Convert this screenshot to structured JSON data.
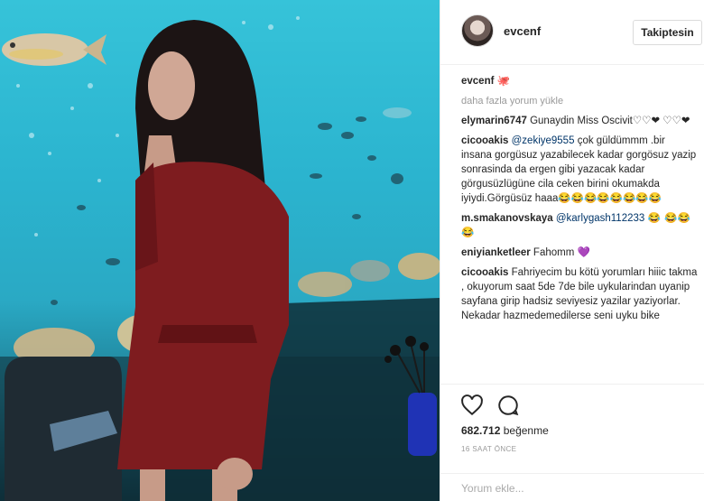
{
  "post": {
    "username": "evcenf",
    "follow_label": "Takiptesin",
    "caption_user": "evcenf",
    "caption_text": "🐙",
    "load_more": "daha fazla yorum yükle",
    "comments": [
      {
        "user": "elymarin6747",
        "text": "Gunaydin Miss Oscivit♡♡❤ ♡♡❤"
      },
      {
        "user": "cicooakis",
        "mention": "@zekiye9555",
        "text": "çok güldümmm .bir insana gorgüsuz yazabilecek kadar gorgösuz yazip sonrasinda da ergen gibi yazacak kadar görgusüzlügüne cila ceken birini okumakda iyiydi.Görgüsüz haaa😂😂😂😂😂😂😂😂"
      },
      {
        "user": "m.smakanovskaya",
        "mention": "@karlygash112233",
        "text": "😂 😂😂😂"
      },
      {
        "user": "eniyianketleer",
        "text": "Fahomm 💜"
      },
      {
        "user": "cicooakis",
        "text": "Fahriyecim bu kötü yorumları hiiic takma , okuyorum saat 5de 7de bile uykularindan uyanip sayfana girip hadsiz seviyesiz yazilar yaziyorlar. Nekadar hazmedemedilerse seni uyku bike"
      }
    ],
    "likes_count": "682.712",
    "likes_label": "beğenme",
    "time_ago": "16 SAAT ÖNCE",
    "comment_placeholder": "Yorum ekle..."
  },
  "icons": {
    "like": "heart-icon",
    "comment": "comment-bubble-icon"
  },
  "colors": {
    "mention": "#003569",
    "muted": "#999999",
    "water": "#2bb4cf"
  }
}
